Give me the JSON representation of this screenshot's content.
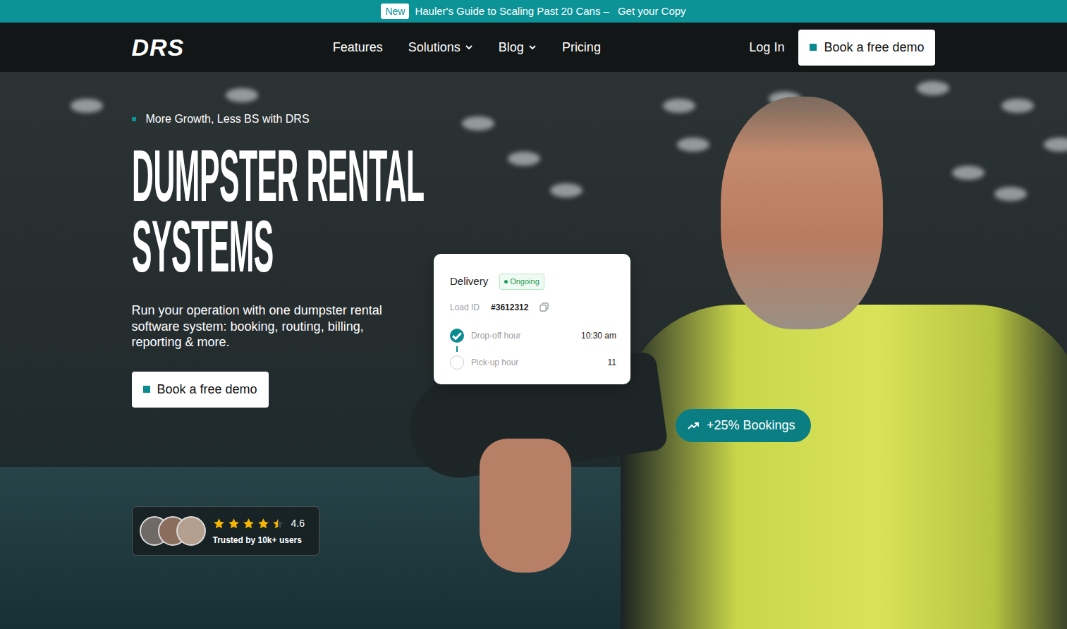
{
  "announcement": {
    "badge": "New",
    "text": "Hauler's Guide to Scaling Past 20 Cans –",
    "link": "Get your Copy"
  },
  "nav": {
    "logo": "DRS",
    "items": [
      {
        "label": "Features",
        "has_menu": false
      },
      {
        "label": "Solutions",
        "has_menu": true
      },
      {
        "label": "Blog",
        "has_menu": true
      },
      {
        "label": "Pricing",
        "has_menu": false
      }
    ],
    "login": "Log In",
    "cta": "Book a free demo"
  },
  "hero": {
    "eyebrow": "More Growth, Less BS with DRS",
    "title_lines": [
      "DUMPSTER RENTAL",
      "SYSTEMS"
    ],
    "description": "Run your operation with one dumpster rental software system: booking, routing, billing, reporting & more.",
    "cta": "Book a free demo",
    "rating": {
      "stars": 4.5,
      "score": "4.6",
      "caption": "Trusted by 10k+ users"
    }
  },
  "delivery_card": {
    "title": "Delivery",
    "status": "Ongoing",
    "load_label": "Load ID",
    "load_id": "#3612312",
    "steps": [
      {
        "label": "Drop-off hour",
        "time": "10:30 am",
        "done": true
      },
      {
        "label": "Pick-up hour",
        "time": "11",
        "done": false
      }
    ]
  },
  "stat_badge": "+25% Bookings"
}
